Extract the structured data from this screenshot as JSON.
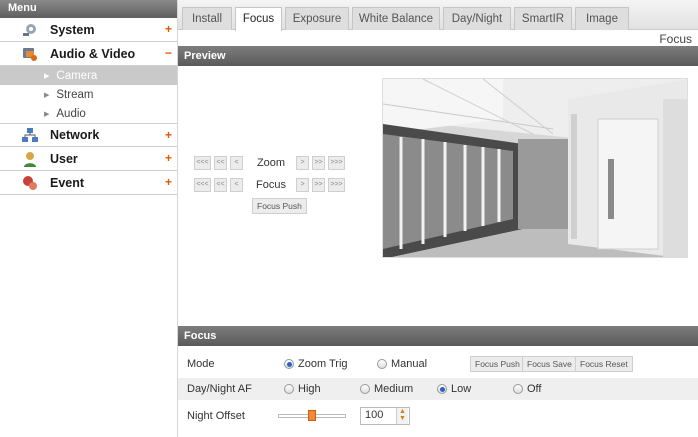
{
  "sidebar": {
    "header": "Menu",
    "sections": [
      {
        "label": "System",
        "toggle": "+",
        "icon": "gear-icon"
      },
      {
        "label": "Audio & Video",
        "toggle": "−",
        "icon": "video-camera-icon"
      },
      {
        "label": "Network",
        "toggle": "+",
        "icon": "network-icon"
      },
      {
        "label": "User",
        "toggle": "+",
        "icon": "user-icon"
      },
      {
        "label": "Event",
        "toggle": "+",
        "icon": "event-icon"
      }
    ],
    "submenu": [
      {
        "label": "Camera",
        "active": true
      },
      {
        "label": "Stream",
        "active": false
      },
      {
        "label": "Audio",
        "active": false
      }
    ]
  },
  "tabs": [
    {
      "label": "Install",
      "active": false
    },
    {
      "label": "Focus",
      "active": true
    },
    {
      "label": "Exposure",
      "active": false
    },
    {
      "label": "White Balance",
      "active": false
    },
    {
      "label": "Day/Night",
      "active": false
    },
    {
      "label": "SmartIR",
      "active": false
    },
    {
      "label": "Image",
      "active": false
    }
  ],
  "page_title": "Focus",
  "preview": {
    "header": "Preview",
    "zoom": {
      "label": "Zoom",
      "left": [
        "<<<",
        "<<",
        "<"
      ],
      "right": [
        ">",
        ">>",
        ">>>"
      ]
    },
    "focus": {
      "label": "Focus",
      "left": [
        "<<<",
        "<<",
        "<"
      ],
      "right": [
        ">",
        ">>",
        ">>>"
      ]
    },
    "focus_push_label": "Focus Push"
  },
  "focus": {
    "header": "Focus",
    "mode": {
      "label": "Mode",
      "options": [
        "Zoom Trig",
        "Manual"
      ],
      "selected": "Zoom Trig",
      "buttons": [
        "Focus Push",
        "Focus Save",
        "Focus Reset"
      ]
    },
    "day_night_af": {
      "label": "Day/Night AF",
      "options": [
        "High",
        "Medium",
        "Low",
        "Off"
      ],
      "selected": "Low"
    },
    "night_offset": {
      "label": "Night Offset",
      "value": "100",
      "slider_fraction": 0.5
    }
  },
  "colors": {
    "accent_orange": "#e05a00",
    "header_gray": "#5a5a5a",
    "radio_blue": "#2a62c4"
  }
}
